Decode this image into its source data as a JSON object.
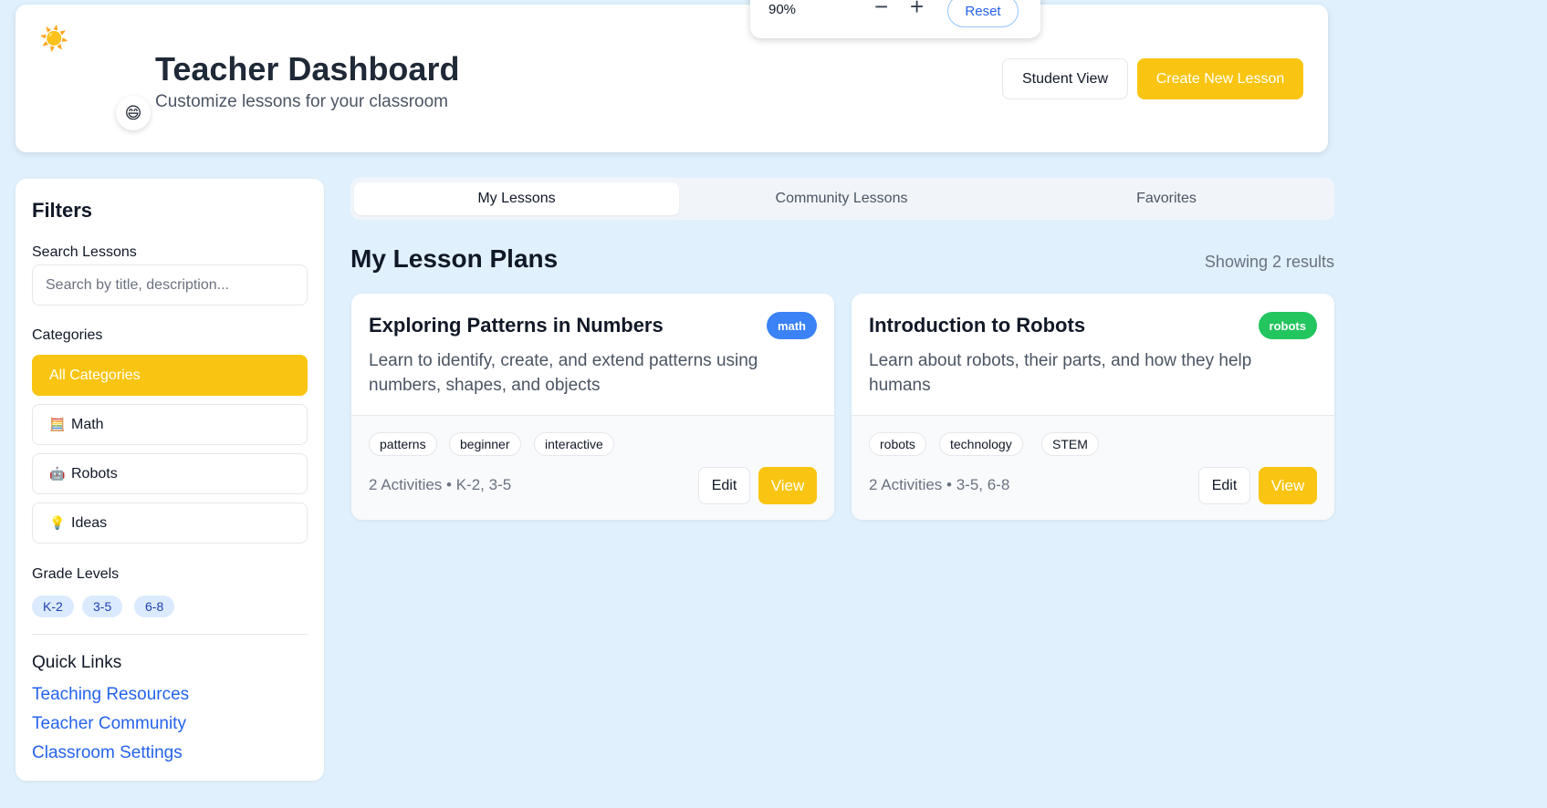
{
  "header": {
    "title": "Teacher Dashboard",
    "subtitle": "Customize lessons for your classroom",
    "sun_icon": "☀️",
    "smile_icon": "😄",
    "student_view_label": "Student View",
    "create_lesson_label": "Create New Lesson"
  },
  "zoom": {
    "value": "90%",
    "minus": "−",
    "plus": "+",
    "reset_label": "Reset"
  },
  "sidebar": {
    "title": "Filters",
    "search_label": "Search Lessons",
    "search_placeholder": "Search by title, description...",
    "categories_label": "Categories",
    "categories": [
      {
        "label": "All Categories",
        "icon": ""
      },
      {
        "label": "Math",
        "icon": "🧮"
      },
      {
        "label": "Robots",
        "icon": "🤖"
      },
      {
        "label": "Ideas",
        "icon": "💡"
      }
    ],
    "grades_label": "Grade Levels",
    "grades": [
      "K-2",
      "3-5",
      "6-8"
    ],
    "quick_links_title": "Quick Links",
    "quick_links": [
      "Teaching Resources",
      "Teacher Community",
      "Classroom Settings"
    ]
  },
  "tabs": [
    "My Lessons",
    "Community Lessons",
    "Favorites"
  ],
  "main": {
    "section_title": "My Lesson Plans",
    "results_text": "Showing 2 results"
  },
  "lessons": [
    {
      "title": "Exploring Patterns in Numbers",
      "badge": "math",
      "badge_color": "#3b82f6",
      "description": "Learn to identify, create, and extend patterns using numbers, shapes, and objects",
      "tags": [
        "patterns",
        "beginner",
        "interactive"
      ],
      "meta": "2 Activities • K-2, 3-5",
      "edit_label": "Edit",
      "view_label": "View"
    },
    {
      "title": "Introduction to Robots",
      "badge": "robots",
      "badge_color": "#22c55e",
      "description": "Learn about robots, their parts, and how they help humans",
      "tags": [
        "robots",
        "technology",
        "STEM"
      ],
      "meta": "2 Activities • 3-5, 6-8",
      "edit_label": "Edit",
      "view_label": "View"
    }
  ],
  "colors": {
    "accent": "#f9c512",
    "link": "#2563eb",
    "background": "#e0f0fc"
  }
}
